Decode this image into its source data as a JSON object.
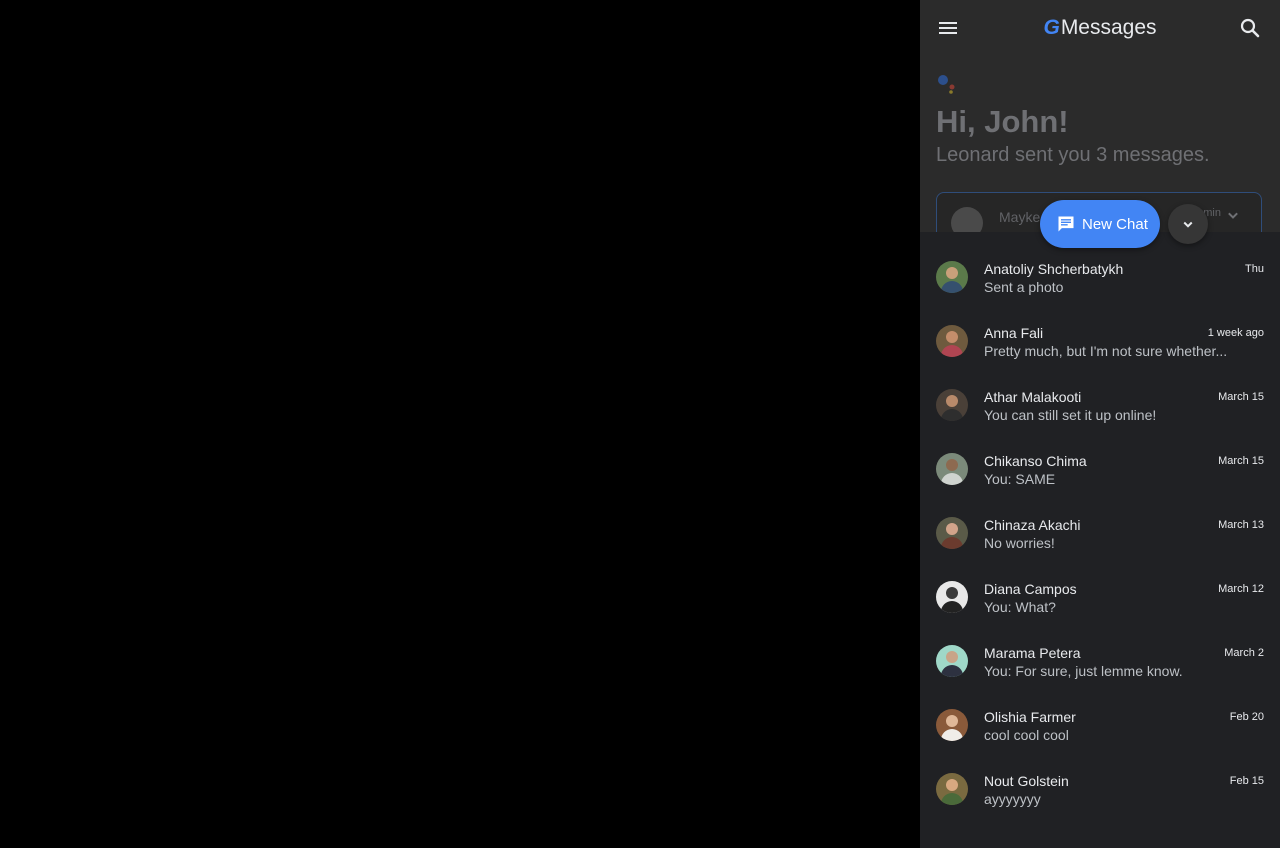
{
  "header": {
    "logo_letter": "G",
    "title": "Messages",
    "menu_icon": "menu-icon",
    "search_icon": "search-icon"
  },
  "assistant": {
    "greeting": "Hi, John!",
    "subtitle": "Leonard sent you 3 messages.",
    "card": {
      "name": "Mayke",
      "time": "min"
    }
  },
  "fab": {
    "new_chat_label": "New Chat",
    "new_chat_icon": "message-icon",
    "collapse_icon": "chevron-down-icon"
  },
  "colors": {
    "accent": "#4285f4",
    "panel_bg": "#202124",
    "topbar_bg": "#2b2b2b"
  },
  "conversations": [
    {
      "name": "Anatoliy Shcherbatykh",
      "preview": "Sent a photo",
      "time": "Thu"
    },
    {
      "name": "Anna Fali",
      "preview": "Pretty much, but I'm not sure whether...",
      "time": "1 week ago"
    },
    {
      "name": "Athar Malakooti",
      "preview": "You can still set it up online!",
      "time": "March 15"
    },
    {
      "name": "Chikanso Chima",
      "preview": "You: SAME",
      "time": "March 15"
    },
    {
      "name": "Chinaza Akachi",
      "preview": "No worries!",
      "time": "March 13"
    },
    {
      "name": "Diana Campos",
      "preview": "You: What?",
      "time": "March 12"
    },
    {
      "name": "Marama Petera",
      "preview": "You: For sure, just lemme know.",
      "time": "March 2"
    },
    {
      "name": "Olishia Farmer",
      "preview": "cool cool cool",
      "time": "Feb 20"
    },
    {
      "name": "Nout Golstein",
      "preview": "ayyyyyyy",
      "time": "Feb 15"
    }
  ]
}
